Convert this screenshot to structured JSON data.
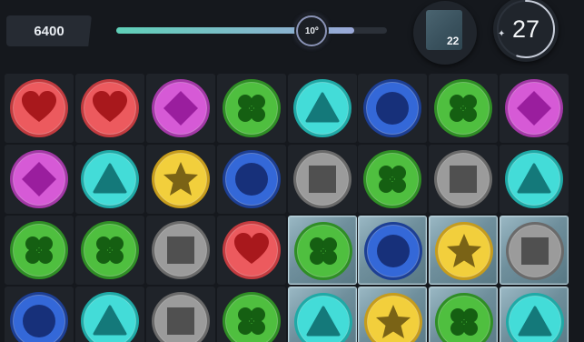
{
  "hud": {
    "score": "6400",
    "progress": {
      "label": "10º",
      "fraction": 0.88
    },
    "target": {
      "icon": "ice-tile-icon",
      "count": "22"
    },
    "moves": {
      "count": "27",
      "fraction": 0.55
    }
  },
  "colors": {
    "red": {
      "fill": "#ec5a5e",
      "rim": "#c23b3f",
      "symbol": "#a8181c"
    },
    "magenta": {
      "fill": "#d65ad6",
      "rim": "#a338a6",
      "symbol": "#9a1e9e"
    },
    "green": {
      "fill": "#4fbf3f",
      "rim": "#2f8e25",
      "symbol": "#155f12"
    },
    "cyan": {
      "fill": "#43dcd8",
      "rim": "#1fa9a6",
      "symbol": "#14797a"
    },
    "blue": {
      "fill": "#3468d8",
      "rim": "#1d3f94",
      "symbol": "#17307a"
    },
    "gray": {
      "fill": "#9b9b9b",
      "rim": "#6a6a6a",
      "symbol": "#505050"
    },
    "yellow": {
      "fill": "#f2cf3c",
      "rim": "#c69c1c",
      "symbol": "#7a6316"
    }
  },
  "board": {
    "rows": [
      [
        {
          "color": "red",
          "shape": "heart",
          "ice": false
        },
        {
          "color": "red",
          "shape": "heart",
          "ice": false
        },
        {
          "color": "magenta",
          "shape": "diamond",
          "ice": false
        },
        {
          "color": "green",
          "shape": "clover",
          "ice": false
        },
        {
          "color": "cyan",
          "shape": "triangle",
          "ice": false
        },
        {
          "color": "blue",
          "shape": "circle",
          "ice": false
        },
        {
          "color": "green",
          "shape": "clover",
          "ice": false
        },
        {
          "color": "magenta",
          "shape": "diamond",
          "ice": false
        }
      ],
      [
        {
          "color": "magenta",
          "shape": "diamond",
          "ice": false
        },
        {
          "color": "cyan",
          "shape": "triangle",
          "ice": false
        },
        {
          "color": "yellow",
          "shape": "star",
          "ice": false
        },
        {
          "color": "blue",
          "shape": "circle",
          "ice": false
        },
        {
          "color": "gray",
          "shape": "square",
          "ice": false
        },
        {
          "color": "green",
          "shape": "clover",
          "ice": false
        },
        {
          "color": "gray",
          "shape": "square",
          "ice": false
        },
        {
          "color": "cyan",
          "shape": "triangle",
          "ice": false
        }
      ],
      [
        {
          "color": "green",
          "shape": "clover",
          "ice": false
        },
        {
          "color": "green",
          "shape": "clover",
          "ice": false
        },
        {
          "color": "gray",
          "shape": "square",
          "ice": false
        },
        {
          "color": "red",
          "shape": "heart",
          "ice": false
        },
        {
          "color": "green",
          "shape": "clover",
          "ice": true
        },
        {
          "color": "blue",
          "shape": "circle",
          "ice": true
        },
        {
          "color": "yellow",
          "shape": "star",
          "ice": true
        },
        {
          "color": "gray",
          "shape": "square",
          "ice": true
        }
      ],
      [
        {
          "color": "blue",
          "shape": "circle",
          "ice": false
        },
        {
          "color": "cyan",
          "shape": "triangle",
          "ice": false
        },
        {
          "color": "gray",
          "shape": "square",
          "ice": false
        },
        {
          "color": "green",
          "shape": "clover",
          "ice": false
        },
        {
          "color": "cyan",
          "shape": "triangle",
          "ice": true
        },
        {
          "color": "yellow",
          "shape": "star",
          "ice": true
        },
        {
          "color": "green",
          "shape": "clover",
          "ice": true
        },
        {
          "color": "cyan",
          "shape": "triangle",
          "ice": true
        }
      ]
    ]
  }
}
